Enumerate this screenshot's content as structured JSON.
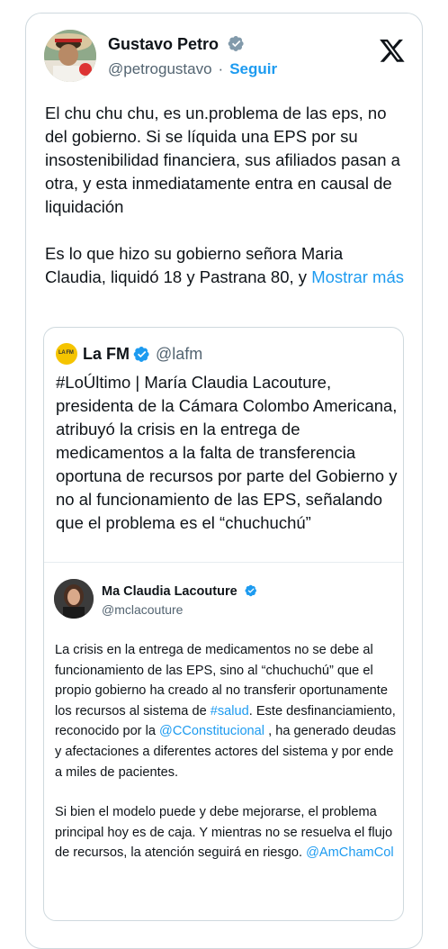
{
  "author": {
    "name": "Gustavo Petro",
    "handle": "@petrogustavo",
    "separator": "·",
    "follow_label": "Seguir"
  },
  "colors": {
    "accent": "#1d9bf0",
    "text": "#0f1419",
    "muted": "#536471",
    "border": "#cfd9de"
  },
  "icons": {
    "verified": "verified-badge-icon",
    "platform": "x-logo-icon"
  },
  "tweet": {
    "paragraph1": "El chu chu chu, es un.problema de las eps, no del gobierno. Si se líquida una EPS por su insostenibilidad financiera, sus afiliados pasan a otra, y esta inmediatamente entra en causal de liquidación",
    "paragraph2": "Es lo que hizo su gobierno señora Maria Claudia, liquidó 18 y Pastrana 80, y",
    "show_more": "Mostrar más"
  },
  "quoted": {
    "name": "La FM",
    "handle": "@lafm",
    "logo_text": "LA FM",
    "text": "#LoÚltimo | María Claudia Lacouture, presidenta de la Cámara Colombo Americana, atribuyó la crisis en la entrega de medicamentos a la falta de transferencia oportuna de recursos por parte del Gobierno y no al funcionamiento de las EPS, señalando que el problema es el “chuchuchú”",
    "embedded": {
      "name": "Ma Claudia Lacouture",
      "handle": "@mclacouture",
      "p1_a": "La crisis en la entrega de medicamentos no se debe al funcionamiento de las EPS, sino al “chuchuchú” que el propio gobierno ha creado al no transferir oportunamente los recursos al sistema de ",
      "p1_hashtag": "#salud",
      "p1_b": ". Este desfinanciamiento, reconocido por la ",
      "p1_mention": "@CConstitucional",
      "p1_c": " , ha generado deudas y afectaciones a diferentes actores del sistema y por ende a miles de pacientes.",
      "p2_a": "Si bien el modelo puede y debe mejorarse, el problema principal hoy es de caja. Y mientras no se resuelva el flujo de recursos, la atención seguirá en riesgo. ",
      "p2_mention": "@AmChamCol"
    }
  }
}
